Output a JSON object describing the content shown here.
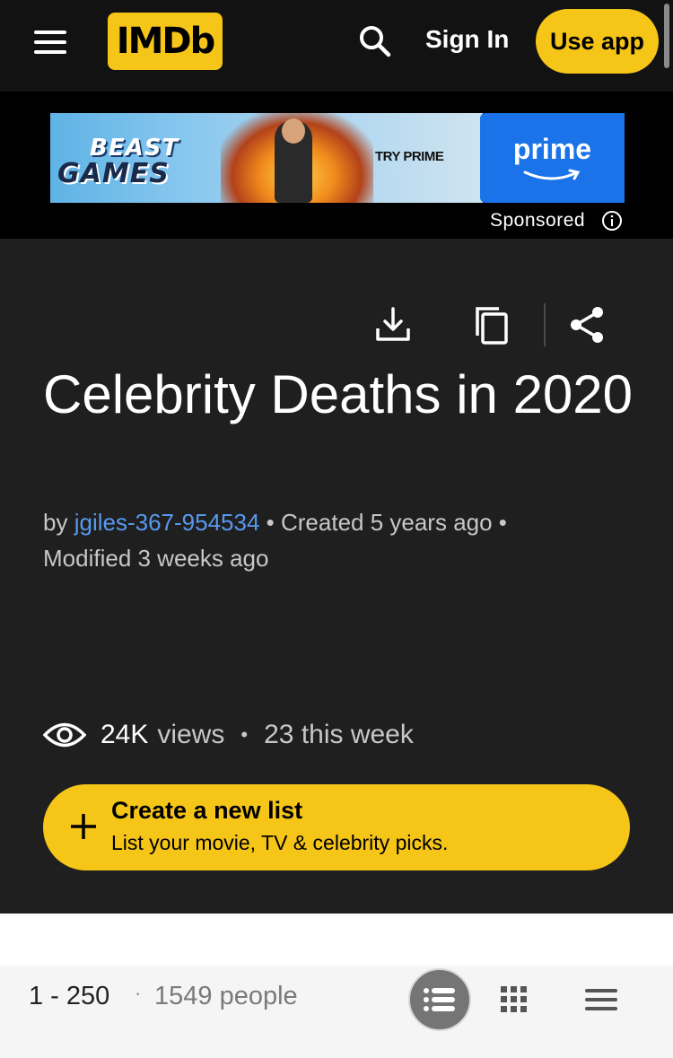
{
  "header": {
    "menu_icon": "hamburger-menu-icon",
    "logo_text": "IMDb",
    "search_icon": "search-icon",
    "signin_label": "Sign In",
    "useapp_label": "Use app"
  },
  "ad": {
    "brand_line1": "BEAST",
    "brand_line2": "GAMES",
    "cta": "TRY PRIME",
    "provider": "prime",
    "sponsored_label": "Sponsored",
    "info_icon": "info-icon"
  },
  "list": {
    "actions": [
      "download-icon",
      "copy-icon",
      "share-icon"
    ],
    "title": "Celebrity Deaths in 2020",
    "by_prefix": "by",
    "author": "jgiles-367-954534",
    "created": "Created 5 years ago",
    "modified": "Modified 3 weeks ago",
    "views_count": "24K",
    "views_label": "views",
    "views_sep": "•",
    "views_week": "23 this week"
  },
  "create": {
    "title": "Create a new list",
    "subtitle": "List your movie, TV & celebrity picks."
  },
  "toolbar": {
    "range": "1 - 250",
    "separator": "·",
    "people": "1549 people",
    "views": [
      "detailed-list-view-icon",
      "grid-view-icon",
      "compact-list-view-icon"
    ]
  },
  "colors": {
    "accent": "#f5c518",
    "link": "#5799ef",
    "background": "#1f1f1f",
    "header": "#121212",
    "prime_blue": "#1a73e8"
  }
}
